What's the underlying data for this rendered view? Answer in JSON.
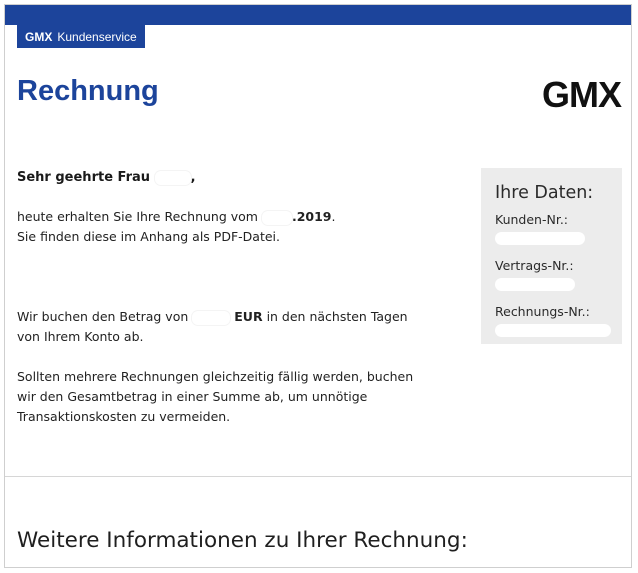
{
  "header": {
    "badge_brand": "GMX",
    "badge_text": "Kundenservice",
    "page_title": "Rechnung",
    "logo": "GMX",
    "brand_color": "#1c449b"
  },
  "letter": {
    "greeting_prefix": "Sehr geehrte Frau",
    "greeting_suffix": ",",
    "line1_prefix": "heute erhalten Sie Ihre Rechnung vom",
    "line1_date_suffix": ".2019",
    "line1_end": ".",
    "line2": "Sie finden diese im Anhang als PDF-Datei.",
    "amount_prefix": "Wir buchen den Betrag von",
    "amount_currency": "EUR",
    "amount_suffix": "in den nächsten Tagen",
    "amount_line2": "von Ihrem Konto ab.",
    "multi_line1": "Sollten mehrere Rechnungen gleichzeitig fällig werden, buchen",
    "multi_line2": "wir den Gesamtbetrag in einer Summe ab, um unnötige",
    "multi_line3": "Transaktionskosten zu vermeiden."
  },
  "data_box": {
    "title": "Ihre Daten:",
    "fields": [
      {
        "label": "Kunden-Nr.:"
      },
      {
        "label": "Vertrags-Nr.:"
      },
      {
        "label": "Rechnungs-Nr.:"
      }
    ]
  },
  "footer": {
    "section_title": "Weitere Informationen zu Ihrer Rechnung:"
  }
}
